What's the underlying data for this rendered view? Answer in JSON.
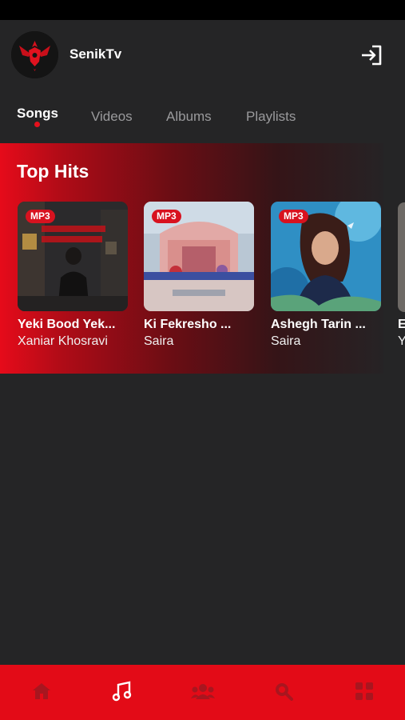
{
  "app": {
    "name": "SenikTv",
    "avatar_icon": "phoenix-logo-icon",
    "logout_icon": "logout-icon"
  },
  "tabs": [
    {
      "label": "Songs",
      "active": true
    },
    {
      "label": "Videos",
      "active": false
    },
    {
      "label": "Albums",
      "active": false
    },
    {
      "label": "Playlists",
      "active": false
    }
  ],
  "section": {
    "title": "Top Hits",
    "cards": [
      {
        "badge": "MP3",
        "title": "Yeki Bood Yek...",
        "artist": "Xaniar Khosravi"
      },
      {
        "badge": "MP3",
        "title": "Ki Fekresho ...",
        "artist": "Saira"
      },
      {
        "badge": "MP3",
        "title": "Ashegh Tarin ...",
        "artist": "Saira"
      }
    ],
    "peek_card": {
      "title": "E",
      "artist": "Y"
    }
  },
  "bottom_nav": [
    {
      "icon": "home-icon",
      "active": false
    },
    {
      "icon": "music-note-icon",
      "active": true
    },
    {
      "icon": "users-icon",
      "active": false
    },
    {
      "icon": "search-icon",
      "active": false
    },
    {
      "icon": "grid-icon",
      "active": false
    }
  ],
  "colors": {
    "accent": "#e30b17",
    "background": "#252526",
    "nav_inactive": "#a8161f",
    "nav_active": "#ffffff"
  }
}
